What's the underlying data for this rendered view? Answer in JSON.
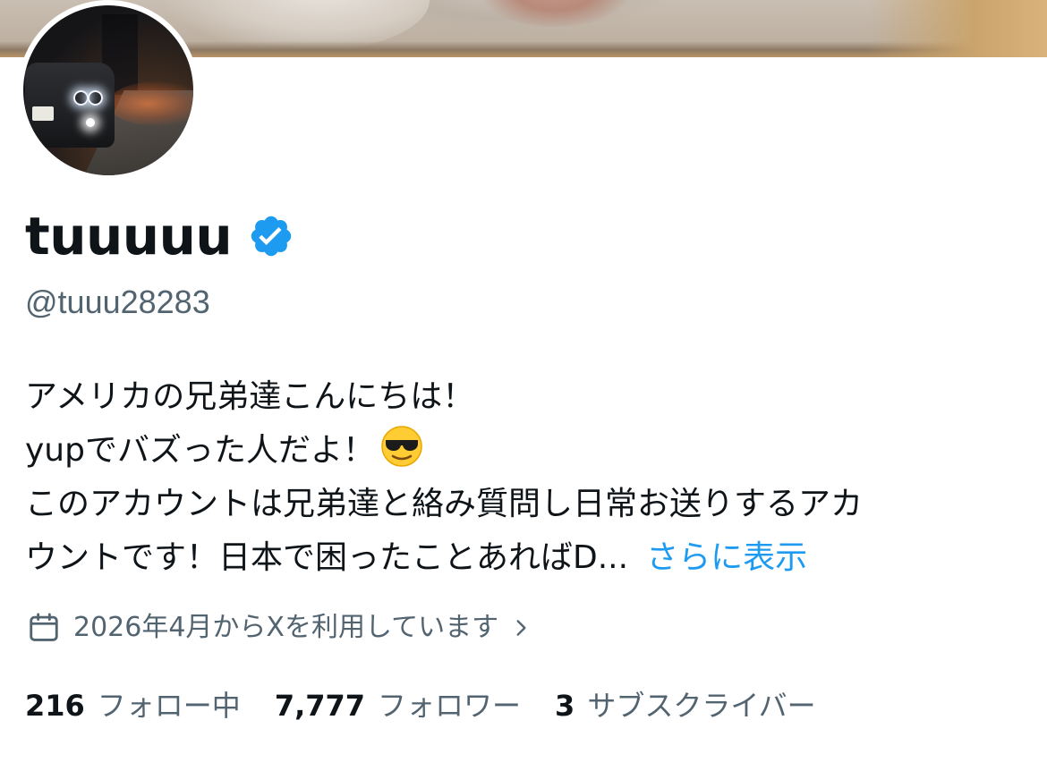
{
  "profile": {
    "display_name": "tuuuuu",
    "verified": true,
    "handle": "@tuuu28283",
    "bio_lines": [
      "アメリカの兄弟達こんにちは！",
      "yupでバズった人だよ！",
      "このアカウントは兄弟達と絡み質問し日常お送りするアカ",
      "ウントです！日本で困ったことあればD..."
    ],
    "bio_emoji": "😎",
    "show_more_label": "さらに表示",
    "joined_text": "2026年4月からXを利用しています"
  },
  "stats": {
    "following_count": "216",
    "following_label": "フォロー中",
    "followers_count": "7,777",
    "followers_label": "フォロワー",
    "subscribers_count": "3",
    "subscribers_label": "サブスクライバー"
  },
  "colors": {
    "text_primary": "#0f1419",
    "text_secondary": "#536471",
    "accent": "#1d9bf0"
  },
  "icons": {
    "verified": "verified-badge-icon",
    "calendar": "calendar-icon",
    "chevron": "chevron-right-icon"
  }
}
